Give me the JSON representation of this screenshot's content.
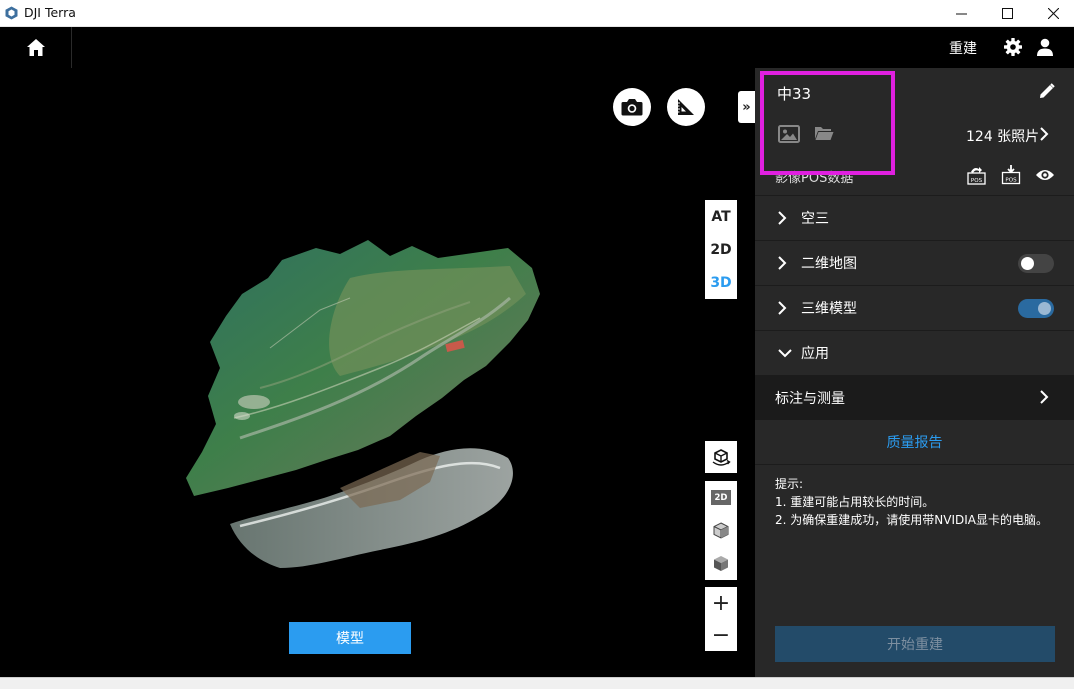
{
  "window": {
    "title": "DJI Terra",
    "controls": {
      "minimize_icon": "minimize-icon",
      "maximize_icon": "maximize-icon",
      "close_icon": "close-icon"
    }
  },
  "topnav": {
    "home_icon": "home-icon",
    "rebuild_label": "重建",
    "settings_icon": "gear-icon",
    "user_icon": "user-icon"
  },
  "viewport": {
    "tools": {
      "screenshot_icon": "camera-icon",
      "measure_icon": "ruler-triangle-icon"
    },
    "collapse_label": "»",
    "view_switch": [
      {
        "label": "AT",
        "active": false
      },
      {
        "label": "2D",
        "active": false
      },
      {
        "label": "3D",
        "active": true
      }
    ],
    "view_mode_2d_label": "2D",
    "zoom_in_label": "+",
    "zoom_out_label": "−",
    "model_button_label": "模型"
  },
  "panel": {
    "project_name": "中33",
    "photo_count": "124 张照片",
    "pos_label": "影像POS数据",
    "pos_import_badge": "POS",
    "pos_export_badge": "POS",
    "sections": {
      "aerial": "空三",
      "map2d": "二维地图",
      "model3d": "三维模型",
      "apps": "应用"
    },
    "toggles": {
      "map2d_on": false,
      "model3d_on": true
    },
    "annotation_label": "标注与测量",
    "quality_report_label": "质量报告",
    "tips": {
      "title": "提示:",
      "line1": "1. 重建可能占用较长的时间。",
      "line2": "2. 为确保重建成功，请使用带NVIDIA显卡的电脑。"
    },
    "start_button_label": "开始重建"
  },
  "colors": {
    "accent": "#2b9cf0",
    "panel_bg": "#282828",
    "highlight": "#e020e0",
    "disabled_button": "#234b69"
  }
}
